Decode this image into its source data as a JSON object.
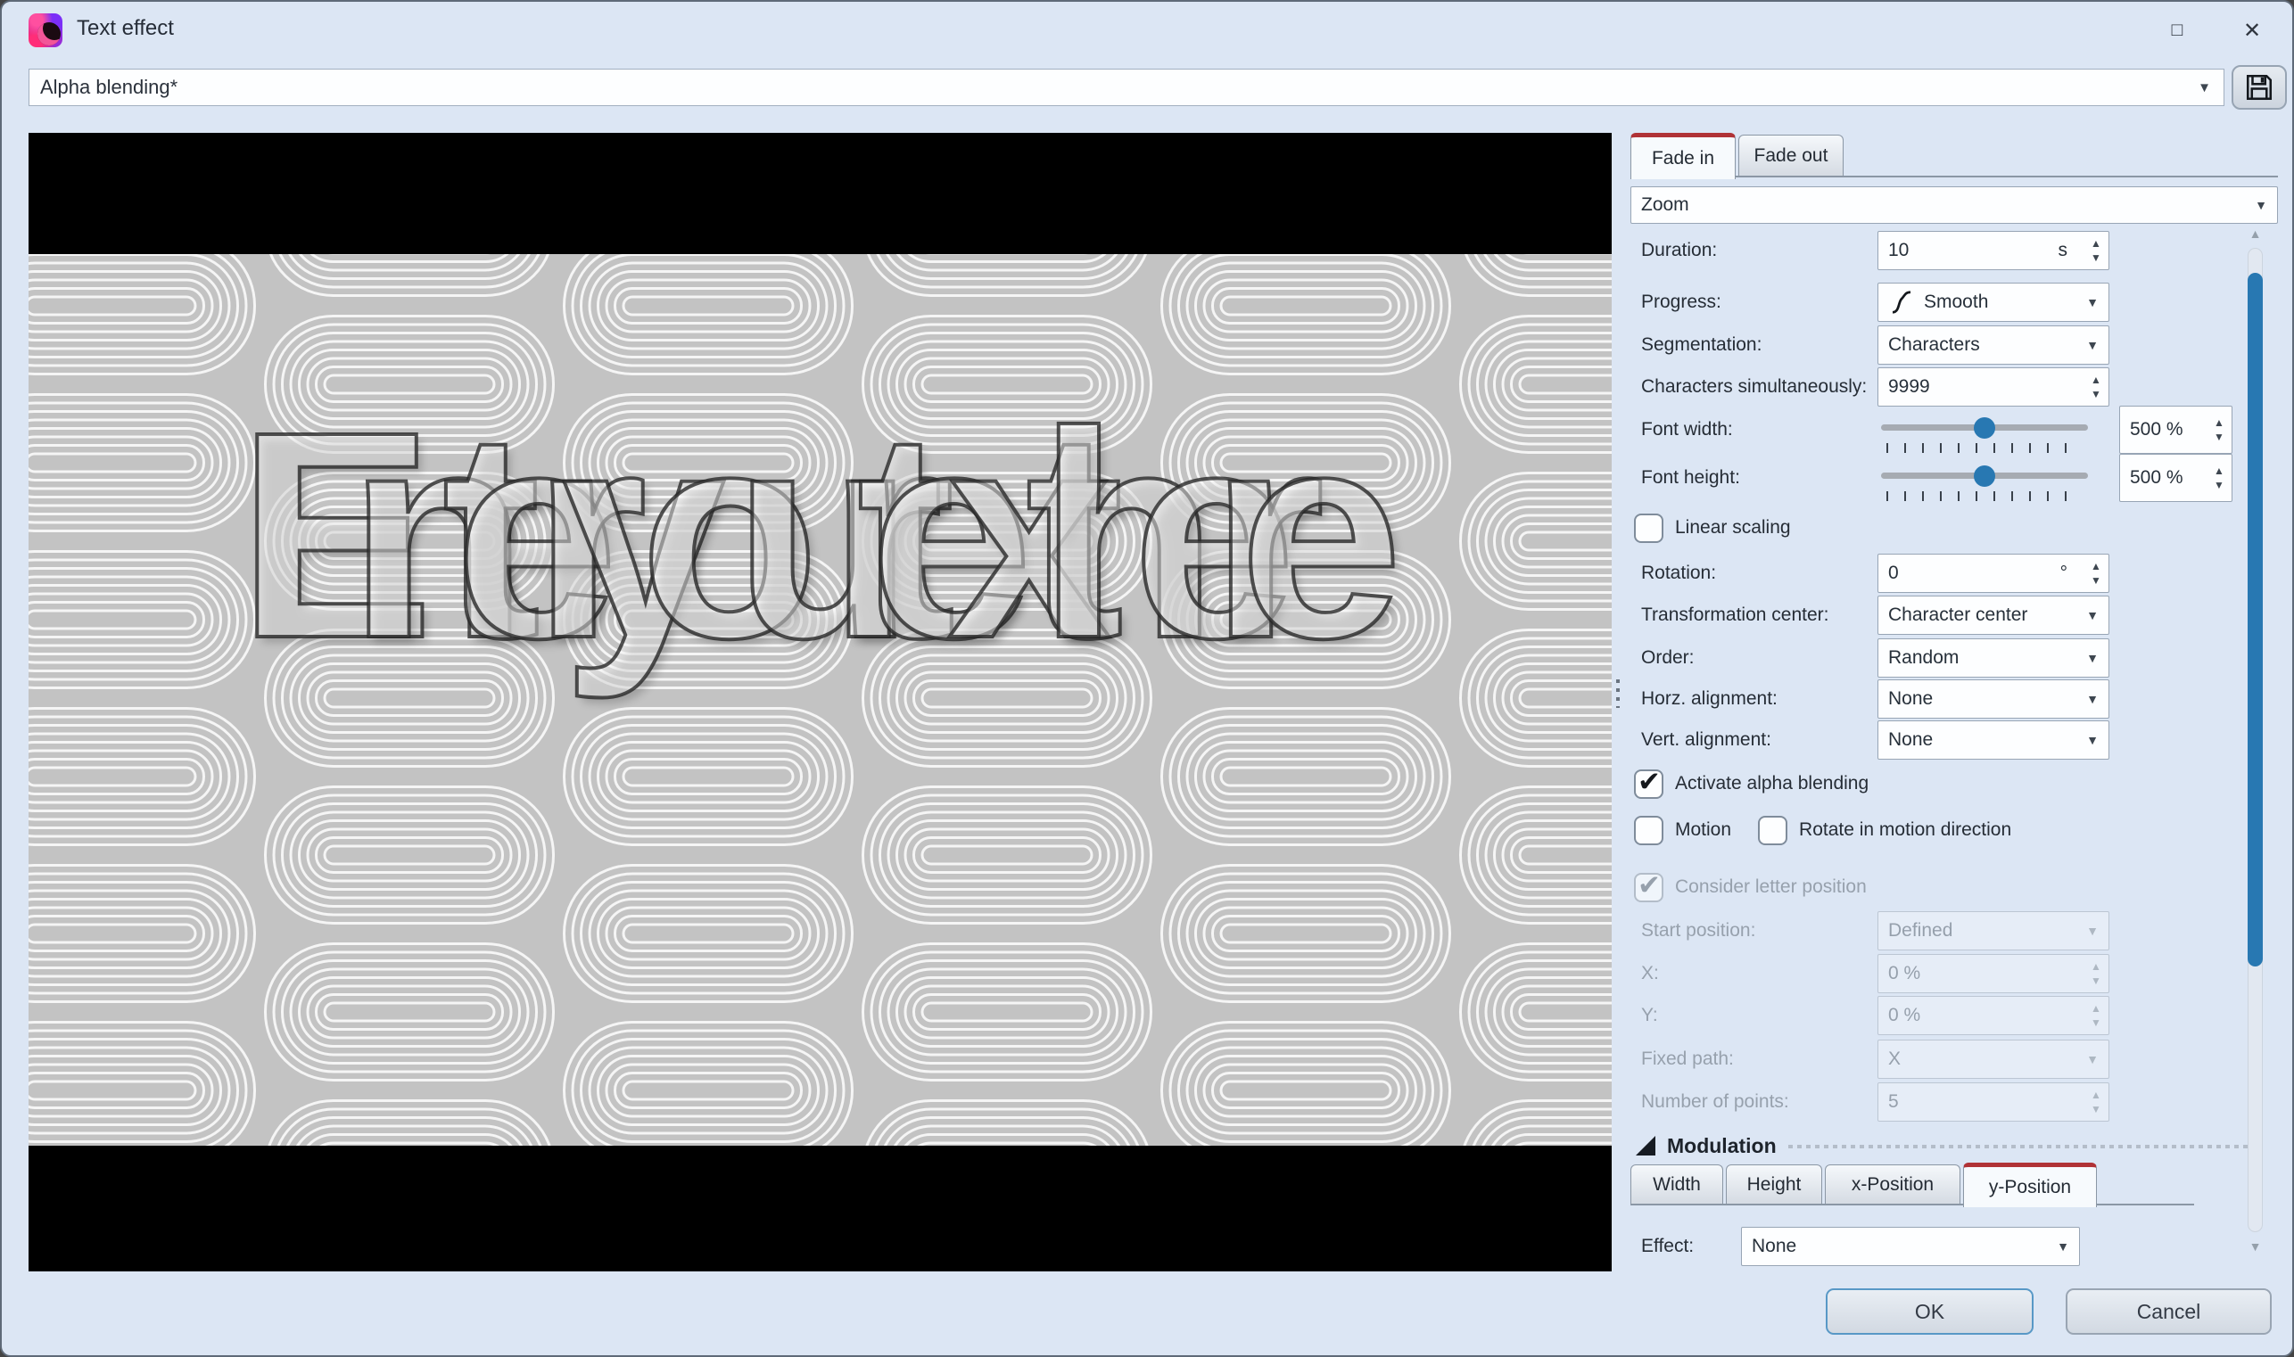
{
  "window": {
    "title": "Text effect"
  },
  "icons": {
    "up": "▲",
    "down": "▼",
    "dropdown": "▼",
    "check": "✔",
    "maximize": "□",
    "close": "✕"
  },
  "preset": {
    "value": "Alpha blending*"
  },
  "preview": {
    "phrase": "Enter your text here"
  },
  "panel": {
    "tabs": {
      "fade_in": "Fade in",
      "fade_out": "Fade out"
    },
    "effect_type": "Zoom",
    "duration": {
      "label": "Duration:",
      "value": "10",
      "suffix": "s"
    },
    "progress": {
      "label": "Progress:",
      "value": "Smooth"
    },
    "segmentation": {
      "label": "Segmentation:",
      "value": "Characters"
    },
    "characters_simultaneously": {
      "label": "Characters simultaneously:",
      "value": "9999"
    },
    "font_width": {
      "label": "Font width:",
      "value": "500 %",
      "slider_percent": 50
    },
    "font_height": {
      "label": "Font height:",
      "value": "500 %",
      "slider_percent": 50
    },
    "linear_scaling": {
      "label": "Linear scaling",
      "checked": false
    },
    "rotation": {
      "label": "Rotation:",
      "value": "0",
      "suffix": "°"
    },
    "transformation_center": {
      "label": "Transformation center:",
      "value": "Character center"
    },
    "order": {
      "label": "Order:",
      "value": "Random"
    },
    "horz_alignment": {
      "label": "Horz. alignment:",
      "value": "None"
    },
    "vert_alignment": {
      "label": "Vert. alignment:",
      "value": "None"
    },
    "activate_alpha_blending": {
      "label": "Activate alpha blending",
      "checked": true
    },
    "motion": {
      "label": "Motion",
      "checked": false
    },
    "rotate_in_motion_direction": {
      "label": "Rotate in motion direction",
      "checked": false
    },
    "consider_letter_position": {
      "label": "Consider letter position",
      "checked": true,
      "disabled": true
    },
    "start_position": {
      "label": "Start position:",
      "value": "Defined",
      "disabled": true
    },
    "x": {
      "label": "X:",
      "value": "0 %",
      "disabled": true
    },
    "y": {
      "label": "Y:",
      "value": "0 %",
      "disabled": true
    },
    "fixed_path": {
      "label": "Fixed path:",
      "value": "X",
      "disabled": true
    },
    "number_of_points": {
      "label": "Number of points:",
      "value": "5",
      "disabled": true
    },
    "modulation": {
      "title": "Modulation",
      "tabs": [
        "Width",
        "Height",
        "x-Position",
        "y-Position"
      ],
      "active_tab": "y-Position",
      "effect_label": "Effect:",
      "effect_value": "None"
    }
  },
  "buttons": {
    "ok": "OK",
    "cancel": "Cancel"
  },
  "colors": {
    "accent_blue": "#2878b2",
    "tab_accent_red": "#b03236",
    "pattern_bg": "#c3c3c3",
    "pattern_line": "#f5f5f5",
    "dialog_bg": "#dce6f4"
  }
}
